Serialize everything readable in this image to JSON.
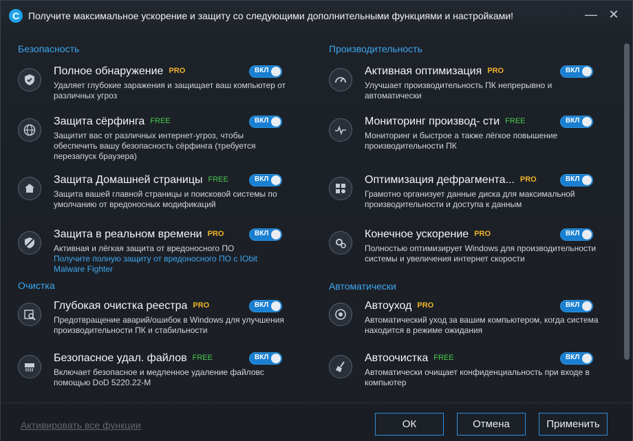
{
  "window": {
    "title": "Получите максимальное ускорение и защиту со следующими дополнительными функциями и настройками!",
    "app_icon_glyph": "C",
    "minimize_glyph": "—",
    "close_glyph": "✕"
  },
  "sections": {
    "security": "Безопасность",
    "performance": "Производительность",
    "cleanup": "Очистка",
    "automatic": "Автоматически"
  },
  "toggle_label": "ВКЛ",
  "items": [
    {
      "name": "Полное обнаружение",
      "badge": "PRO",
      "desc": "Удаляет глубокие заражения и защищает ваш компьютер от различных угроз",
      "icon": "shield-icon"
    },
    {
      "name": "Защита сёрфинга",
      "badge": "FREE",
      "desc": "Защитит вас от различных интернет-угроз, чтобы обеспечить вашу безопасность сёрфинга (требуется перезапуск браузера)",
      "icon": "globe-icon"
    },
    {
      "name": "Защита Домашней страницы",
      "badge": "FREE",
      "desc": "Защита вашей главной страницы и поисковой системы по умолчанию от вредоносных модификаций",
      "icon": "home-shield-icon"
    },
    {
      "name": "Защита в реальном времени",
      "badge": "PRO",
      "desc": "Активная и лёгкая защита от вредоносного ПО",
      "link": "Получите полную защиту от вредоносного ПО с IObit Malware Fighter",
      "icon": "realtime-protection-icon"
    },
    {
      "name": "Активная оптимизация",
      "badge": "PRO",
      "desc": "Улучшает производительность ПК непрерывно и автоматически",
      "icon": "speedometer-icon"
    },
    {
      "name": "Мониторинг производ- сти",
      "badge": "FREE",
      "desc": "Мониторинг и быстрое а также лёгкое повышение производительности ПК",
      "icon": "monitor-pulse-icon"
    },
    {
      "name": "Оптимизация дефрагмента...",
      "badge": "PRO",
      "desc": "Грамотно организует данные диска для максимальной производительности и доступа к данным",
      "icon": "defrag-icon"
    },
    {
      "name": "Конечное ускорение",
      "badge": "PRO",
      "desc": "Полностью оптимизирует Windows для производительности системы и увеличения интернет скорости",
      "icon": "gears-icon"
    },
    {
      "name": "Глубокая очистка реестра",
      "badge": "PRO",
      "desc": "Предотвращение аварий/ошибок  в Windows  для улучшения производительности ПК и стабильности",
      "icon": "registry-clean-icon"
    },
    {
      "name": "Безопасное удал. файлов",
      "badge": "FREE",
      "desc": "Включает безопасное и медленное удаление файловс помощью DoD 5220.22-M",
      "icon": "shredder-icon"
    },
    {
      "name": "Автоуход",
      "badge": "PRO",
      "desc": "Автоматический уход за вашим компьютером, когда система находится в режиме ожидания",
      "icon": "auto-care-icon"
    },
    {
      "name": "Автоочистка",
      "badge": "FREE",
      "desc": "Автоматически очищает конфиденциальность при входе в компьютер",
      "icon": "broom-icon"
    }
  ],
  "footer": {
    "activate_all": "Активировать все функции",
    "ok": "ОК",
    "cancel": "Отмена",
    "apply": "Применить"
  },
  "colors": {
    "accent": "#3ea6f0",
    "pro": "#f0b429",
    "free": "#49c94d",
    "toggle_on": "#1a7fd0"
  }
}
